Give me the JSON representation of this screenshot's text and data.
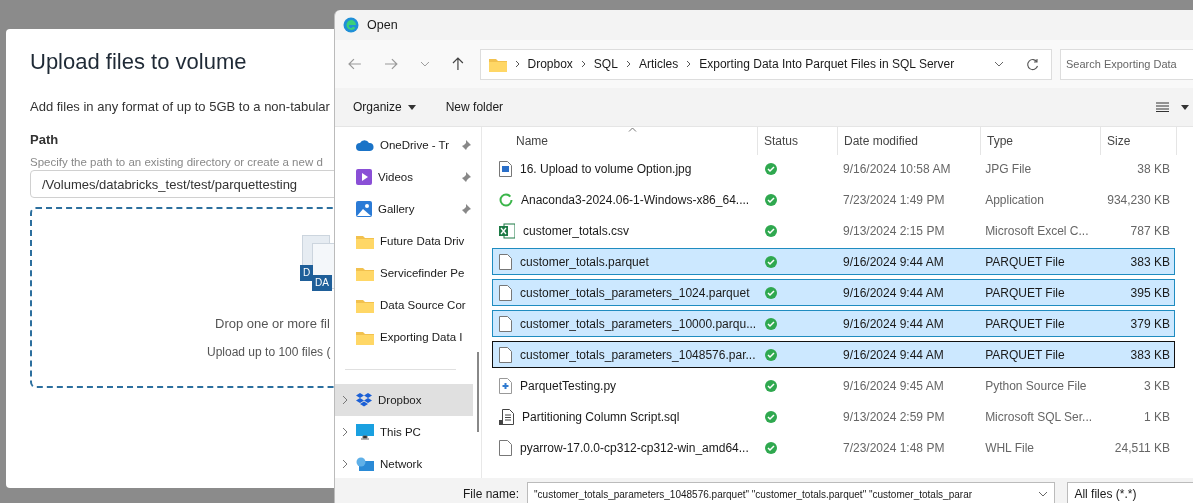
{
  "upload_modal": {
    "title": "Upload files to volume",
    "description": "Add files in any format of up to 5GB to a non-tabular",
    "path_label": "Path",
    "path_hint": "Specify the path to an existing directory or create a new d",
    "path_value": "/Volumes/databricks_test/test/parquettesting",
    "drop_zone": {
      "icon_labels": [
        "D",
        "DA"
      ],
      "text": "Drop one or more fil",
      "limit": "Upload up to 100 files ("
    }
  },
  "open_dialog": {
    "title": "Open",
    "breadcrumb": [
      "Dropbox",
      "SQL",
      "Articles",
      "Exporting Data Into Parquet Files in SQL Server"
    ],
    "search": {
      "placeholder": "Search Exporting Data"
    },
    "toolbar": [
      "Organize",
      "New folder"
    ],
    "sidebar": [
      {
        "label": "OneDrive - Tr",
        "kind": "cloud",
        "pinned": true,
        "selected": false
      },
      {
        "label": "Videos",
        "kind": "videos",
        "pinned": true,
        "selected": false
      },
      {
        "label": "Gallery",
        "kind": "gallery",
        "pinned": true,
        "selected": false
      },
      {
        "label": "Future Data Driv",
        "kind": "folder",
        "pinned": false,
        "selected": false
      },
      {
        "label": "Servicefinder Pe",
        "kind": "folder",
        "pinned": false,
        "selected": false
      },
      {
        "label": "Data Source Cor",
        "kind": "folder",
        "pinned": false,
        "selected": false
      },
      {
        "label": "Exporting Data I",
        "kind": "folder",
        "pinned": false,
        "selected": false
      },
      {
        "kind": "divider"
      },
      {
        "label": "Dropbox",
        "kind": "dropbox",
        "pinned": false,
        "selected": true
      },
      {
        "label": "This PC",
        "kind": "pc",
        "pinned": false,
        "selected": false
      },
      {
        "label": "Network",
        "kind": "network",
        "pinned": false,
        "selected": false
      }
    ],
    "columns": [
      "Name",
      "Status",
      "Date modified",
      "Type",
      "Size"
    ],
    "files": [
      {
        "name": "16. Upload to volume Option.jpg",
        "kind": "image",
        "date": "9/16/2024 10:58 AM",
        "type": "JPG File",
        "size": "38 KB",
        "selected": false,
        "focused": false
      },
      {
        "name": "Anaconda3-2024.06-1-Windows-x86_64....",
        "kind": "installer",
        "date": "7/23/2024 1:49 PM",
        "type": "Application",
        "size": "934,230 KB",
        "selected": false,
        "focused": false
      },
      {
        "name": "customer_totals.csv",
        "kind": "excel",
        "date": "9/13/2024 2:15 PM",
        "type": "Microsoft Excel C...",
        "size": "787 KB",
        "selected": false,
        "focused": false
      },
      {
        "name": "customer_totals.parquet",
        "kind": "blank",
        "date": "9/16/2024 9:44 AM",
        "type": "PARQUET File",
        "size": "383 KB",
        "selected": true,
        "focused": false
      },
      {
        "name": "customer_totals_parameters_1024.parquet",
        "kind": "blank",
        "date": "9/16/2024 9:44 AM",
        "type": "PARQUET File",
        "size": "395 KB",
        "selected": true,
        "focused": false
      },
      {
        "name": "customer_totals_parameters_10000.parqu...",
        "kind": "blank",
        "date": "9/16/2024 9:44 AM",
        "type": "PARQUET File",
        "size": "379 KB",
        "selected": true,
        "focused": false
      },
      {
        "name": "customer_totals_parameters_1048576.par...",
        "kind": "blank",
        "date": "9/16/2024 9:44 AM",
        "type": "PARQUET File",
        "size": "383 KB",
        "selected": true,
        "focused": true
      },
      {
        "name": "ParquetTesting.py",
        "kind": "python",
        "date": "9/16/2024 9:45 AM",
        "type": "Python Source File",
        "size": "3 KB",
        "selected": false,
        "focused": false
      },
      {
        "name": "Partitioning Column Script.sql",
        "kind": "sql",
        "date": "9/13/2024 2:59 PM",
        "type": "Microsoft SQL Ser...",
        "size": "1 KB",
        "selected": false,
        "focused": false
      },
      {
        "name": "pyarrow-17.0.0-cp312-cp312-win_amd64...",
        "kind": "blank",
        "date": "7/23/2024 1:48 PM",
        "type": "WHL File",
        "size": "24,511 KB",
        "selected": false,
        "focused": false
      }
    ],
    "file_name_label": "File name:",
    "file_name_value": "\"customer_totals_parameters_1048576.parquet\" \"customer_totals.parquet\" \"customer_totals_parar",
    "file_type": "All files (*.*)"
  }
}
